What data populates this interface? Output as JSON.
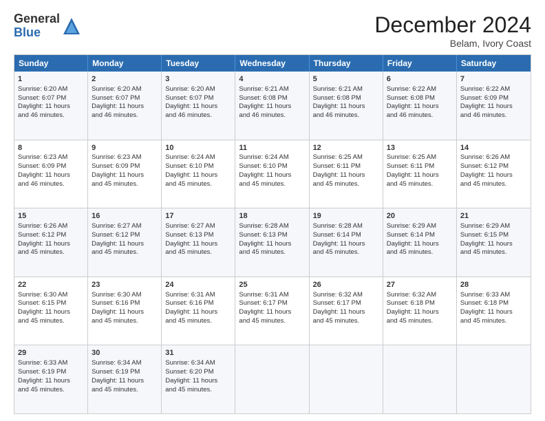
{
  "logo": {
    "general": "General",
    "blue": "Blue"
  },
  "header": {
    "month": "December 2024",
    "location": "Belam, Ivory Coast"
  },
  "weekdays": [
    "Sunday",
    "Monday",
    "Tuesday",
    "Wednesday",
    "Thursday",
    "Friday",
    "Saturday"
  ],
  "rows": [
    [
      {
        "day": "1",
        "lines": [
          "Sunrise: 6:20 AM",
          "Sunset: 6:07 PM",
          "Daylight: 11 hours",
          "and 46 minutes."
        ]
      },
      {
        "day": "2",
        "lines": [
          "Sunrise: 6:20 AM",
          "Sunset: 6:07 PM",
          "Daylight: 11 hours",
          "and 46 minutes."
        ]
      },
      {
        "day": "3",
        "lines": [
          "Sunrise: 6:20 AM",
          "Sunset: 6:07 PM",
          "Daylight: 11 hours",
          "and 46 minutes."
        ]
      },
      {
        "day": "4",
        "lines": [
          "Sunrise: 6:21 AM",
          "Sunset: 6:08 PM",
          "Daylight: 11 hours",
          "and 46 minutes."
        ]
      },
      {
        "day": "5",
        "lines": [
          "Sunrise: 6:21 AM",
          "Sunset: 6:08 PM",
          "Daylight: 11 hours",
          "and 46 minutes."
        ]
      },
      {
        "day": "6",
        "lines": [
          "Sunrise: 6:22 AM",
          "Sunset: 6:08 PM",
          "Daylight: 11 hours",
          "and 46 minutes."
        ]
      },
      {
        "day": "7",
        "lines": [
          "Sunrise: 6:22 AM",
          "Sunset: 6:09 PM",
          "Daylight: 11 hours",
          "and 46 minutes."
        ]
      }
    ],
    [
      {
        "day": "8",
        "lines": [
          "Sunrise: 6:23 AM",
          "Sunset: 6:09 PM",
          "Daylight: 11 hours",
          "and 46 minutes."
        ]
      },
      {
        "day": "9",
        "lines": [
          "Sunrise: 6:23 AM",
          "Sunset: 6:09 PM",
          "Daylight: 11 hours",
          "and 45 minutes."
        ]
      },
      {
        "day": "10",
        "lines": [
          "Sunrise: 6:24 AM",
          "Sunset: 6:10 PM",
          "Daylight: 11 hours",
          "and 45 minutes."
        ]
      },
      {
        "day": "11",
        "lines": [
          "Sunrise: 6:24 AM",
          "Sunset: 6:10 PM",
          "Daylight: 11 hours",
          "and 45 minutes."
        ]
      },
      {
        "day": "12",
        "lines": [
          "Sunrise: 6:25 AM",
          "Sunset: 6:11 PM",
          "Daylight: 11 hours",
          "and 45 minutes."
        ]
      },
      {
        "day": "13",
        "lines": [
          "Sunrise: 6:25 AM",
          "Sunset: 6:11 PM",
          "Daylight: 11 hours",
          "and 45 minutes."
        ]
      },
      {
        "day": "14",
        "lines": [
          "Sunrise: 6:26 AM",
          "Sunset: 6:12 PM",
          "Daylight: 11 hours",
          "and 45 minutes."
        ]
      }
    ],
    [
      {
        "day": "15",
        "lines": [
          "Sunrise: 6:26 AM",
          "Sunset: 6:12 PM",
          "Daylight: 11 hours",
          "and 45 minutes."
        ]
      },
      {
        "day": "16",
        "lines": [
          "Sunrise: 6:27 AM",
          "Sunset: 6:12 PM",
          "Daylight: 11 hours",
          "and 45 minutes."
        ]
      },
      {
        "day": "17",
        "lines": [
          "Sunrise: 6:27 AM",
          "Sunset: 6:13 PM",
          "Daylight: 11 hours",
          "and 45 minutes."
        ]
      },
      {
        "day": "18",
        "lines": [
          "Sunrise: 6:28 AM",
          "Sunset: 6:13 PM",
          "Daylight: 11 hours",
          "and 45 minutes."
        ]
      },
      {
        "day": "19",
        "lines": [
          "Sunrise: 6:28 AM",
          "Sunset: 6:14 PM",
          "Daylight: 11 hours",
          "and 45 minutes."
        ]
      },
      {
        "day": "20",
        "lines": [
          "Sunrise: 6:29 AM",
          "Sunset: 6:14 PM",
          "Daylight: 11 hours",
          "and 45 minutes."
        ]
      },
      {
        "day": "21",
        "lines": [
          "Sunrise: 6:29 AM",
          "Sunset: 6:15 PM",
          "Daylight: 11 hours",
          "and 45 minutes."
        ]
      }
    ],
    [
      {
        "day": "22",
        "lines": [
          "Sunrise: 6:30 AM",
          "Sunset: 6:15 PM",
          "Daylight: 11 hours",
          "and 45 minutes."
        ]
      },
      {
        "day": "23",
        "lines": [
          "Sunrise: 6:30 AM",
          "Sunset: 6:16 PM",
          "Daylight: 11 hours",
          "and 45 minutes."
        ]
      },
      {
        "day": "24",
        "lines": [
          "Sunrise: 6:31 AM",
          "Sunset: 6:16 PM",
          "Daylight: 11 hours",
          "and 45 minutes."
        ]
      },
      {
        "day": "25",
        "lines": [
          "Sunrise: 6:31 AM",
          "Sunset: 6:17 PM",
          "Daylight: 11 hours",
          "and 45 minutes."
        ]
      },
      {
        "day": "26",
        "lines": [
          "Sunrise: 6:32 AM",
          "Sunset: 6:17 PM",
          "Daylight: 11 hours",
          "and 45 minutes."
        ]
      },
      {
        "day": "27",
        "lines": [
          "Sunrise: 6:32 AM",
          "Sunset: 6:18 PM",
          "Daylight: 11 hours",
          "and 45 minutes."
        ]
      },
      {
        "day": "28",
        "lines": [
          "Sunrise: 6:33 AM",
          "Sunset: 6:18 PM",
          "Daylight: 11 hours",
          "and 45 minutes."
        ]
      }
    ],
    [
      {
        "day": "29",
        "lines": [
          "Sunrise: 6:33 AM",
          "Sunset: 6:19 PM",
          "Daylight: 11 hours",
          "and 45 minutes."
        ]
      },
      {
        "day": "30",
        "lines": [
          "Sunrise: 6:34 AM",
          "Sunset: 6:19 PM",
          "Daylight: 11 hours",
          "and 45 minutes."
        ]
      },
      {
        "day": "31",
        "lines": [
          "Sunrise: 6:34 AM",
          "Sunset: 6:20 PM",
          "Daylight: 11 hours",
          "and 45 minutes."
        ]
      },
      {
        "day": "",
        "lines": []
      },
      {
        "day": "",
        "lines": []
      },
      {
        "day": "",
        "lines": []
      },
      {
        "day": "",
        "lines": []
      }
    ]
  ]
}
